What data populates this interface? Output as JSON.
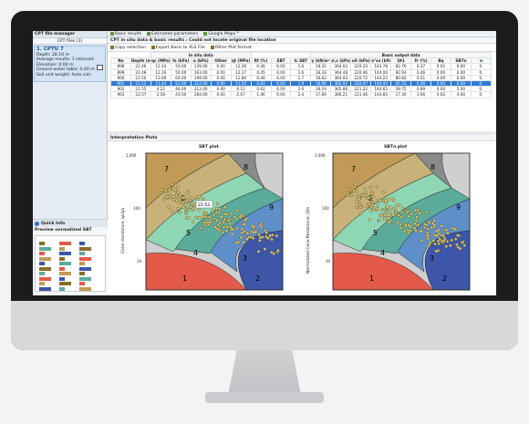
{
  "left_panel": {
    "title": "CPT file manager",
    "tab_label": "CPT files (1)",
    "item": {
      "name": "1. CPTU 7",
      "lines": [
        "Depth: 28.10 m",
        "Average results: 1 intervals",
        "Elevation: 0.00 m",
        "Ground water table: 0.00 m",
        "Soil unit weight: Auto calc."
      ]
    },
    "quick_info": {
      "title": "Quick Info",
      "preview_title": "Preview normalized SBT"
    }
  },
  "tabs": [
    "Basic results",
    "Estimated parameters",
    "Google Maps™"
  ],
  "subtitle": "CPT in situ data & basic results : Could not locate original file location",
  "toolbar": [
    "Copy selection",
    "Export Basic to XLS File",
    "Other Plot format"
  ],
  "table": {
    "group_left": "In situ data",
    "group_right": "Basic output data",
    "headers": [
      "No",
      "Depth (m)",
      "qc (MPa)",
      "fs (kPa)",
      "u (kPa)",
      "Other",
      "qt (MPa)",
      "Rf (%)",
      "SBT",
      "Ic SBT",
      "γ (kN/m³)",
      "σ,v (kPa)",
      "u0 (kPa)",
      "σ'vo (kPa)",
      "Qt1",
      "Fr (%)",
      "Bq",
      "SBTn",
      "n"
    ],
    "rows": [
      [
        "898",
        "22.46",
        "12.24",
        "50.00",
        "139.00",
        "0.00",
        "12.26",
        "0.36",
        "6.00",
        "1.6",
        "18.31",
        "364.02",
        "220.23",
        "143.78",
        "82.76",
        "0.37",
        "0.01",
        "6.00",
        "0."
      ],
      [
        "899",
        "22.48",
        "12.16",
        "50.00",
        "163.00",
        "0.00",
        "12.17",
        "0.45",
        "6.00",
        "1.6",
        "18.33",
        "364.48",
        "220.46",
        "144.00",
        "81.93",
        "0.46",
        "0.00",
        "6.00",
        "0."
      ],
      [
        "900",
        "22.50",
        "11.69",
        "64.00",
        "198.00",
        "0.00",
        "11.80",
        "0.49",
        "6.00",
        "1.7",
        "18.62",
        "364.93",
        "220.72",
        "144.22",
        "80.60",
        "0.51",
        "0.00",
        "6.00",
        "0."
      ],
      [
        "901",
        "22.52",
        "11.44",
        "62.00",
        "212.00",
        "0.00",
        "11.54",
        "0.62",
        "6.00",
        "1.9",
        "18.96",
        "365.92",
        "220.97",
        "144.44",
        "81.53",
        "0.46",
        "0.00",
        "6.00",
        "0."
      ],
      [
        "902",
        "22.55",
        "4.22",
        "46.00",
        "212.00",
        "0.00",
        "6.12",
        "0.62",
        "6.00",
        "2.0",
        "18.19",
        "365.86",
        "221.22",
        "144.65",
        "39.75",
        "0.89",
        "0.00",
        "5.00",
        "0."
      ],
      [
        "903",
        "22.57",
        "2.58",
        "43.00",
        "284.00",
        "0.00",
        "2.67",
        "1.46",
        "6.00",
        "2.4",
        "17.69",
        "366.21",
        "221.46",
        "144.85",
        "17.30",
        "1.66",
        "0.02",
        "4.00",
        "0."
      ]
    ],
    "selected_index": 3
  },
  "plots_header": "Interpretation Plots",
  "plots": [
    {
      "title": "SBT plot",
      "ylabel": "Cone resistance, qc/pa",
      "yticks": [
        "1,000",
        "100",
        "10"
      ],
      "zones": [
        "7",
        "8",
        "9",
        "6",
        "5",
        "4",
        "3",
        "2",
        "1"
      ],
      "tooltip": "22.52"
    },
    {
      "title": "SBTn plot",
      "ylabel": "Normalized Cone Resistance, Qtn",
      "yticks": [
        "1,000",
        "100",
        "10"
      ],
      "zones": [
        "7",
        "8",
        "9",
        "6",
        "5",
        "4",
        "3",
        "2",
        "1"
      ]
    }
  ],
  "colors": {
    "selected_row": "#2e7bd4",
    "zone1": "#e45a4a",
    "zone2": "#3e56a8",
    "zone3": "#5f8fc8",
    "zone4": "#5aab9a",
    "zone5": "#8fd6b5",
    "zone6": "#c8b27a",
    "zone7": "#c29a57",
    "zone8": "#8a8a8a",
    "zone9": "#cfcfcf"
  }
}
